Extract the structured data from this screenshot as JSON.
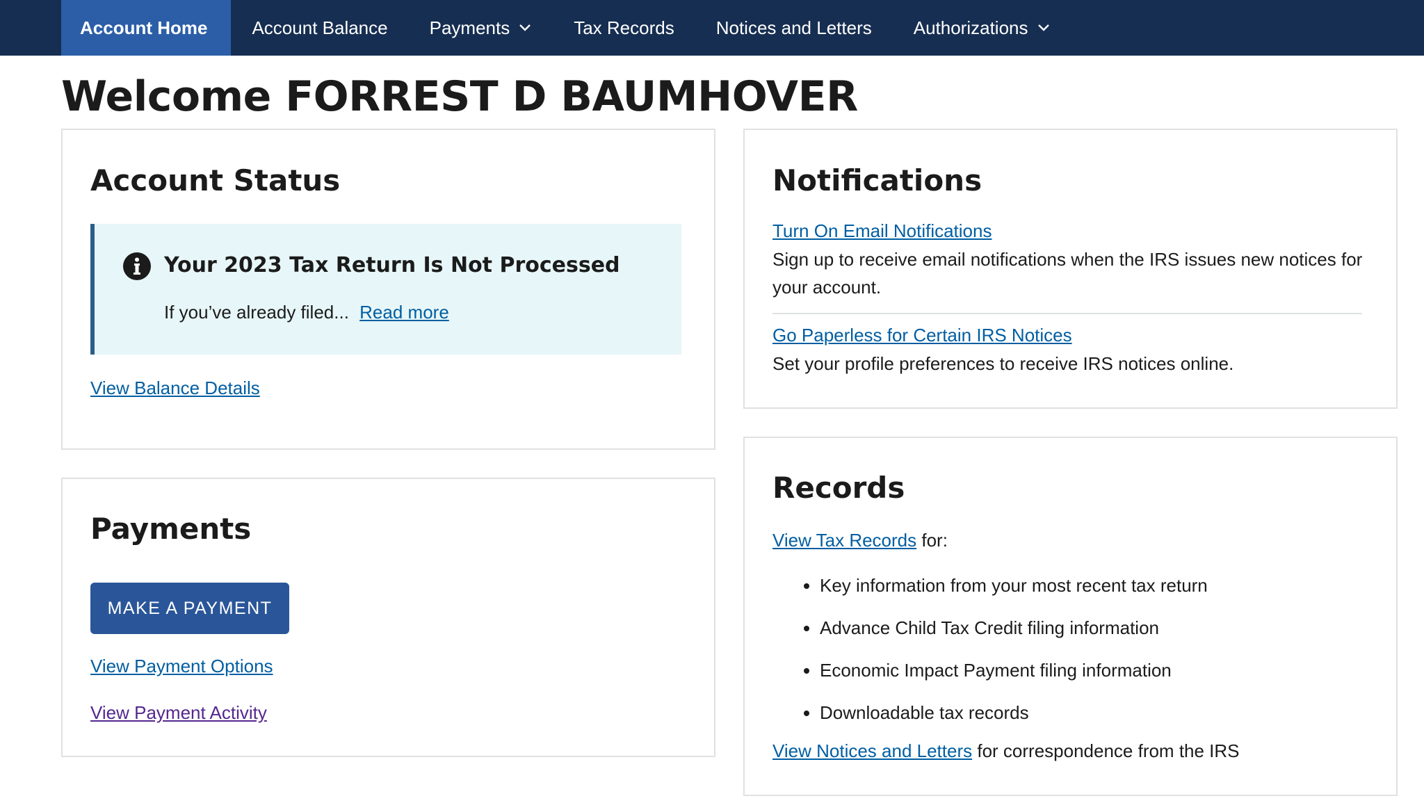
{
  "nav": {
    "items": [
      {
        "label": "Account Home",
        "active": true,
        "dropdown": false
      },
      {
        "label": "Account Balance",
        "active": false,
        "dropdown": false
      },
      {
        "label": "Payments",
        "active": false,
        "dropdown": true
      },
      {
        "label": "Tax Records",
        "active": false,
        "dropdown": false
      },
      {
        "label": "Notices and Letters",
        "active": false,
        "dropdown": false
      },
      {
        "label": "Authorizations",
        "active": false,
        "dropdown": true
      }
    ]
  },
  "page": {
    "title": "Welcome FORREST D BAUMHOVER"
  },
  "account_status": {
    "heading": "Account Status",
    "alert": {
      "icon": "info-icon",
      "title": "Your 2023 Tax Return Is Not Processed",
      "body": "If you’ve already filed...",
      "read_more": "Read more"
    },
    "balance_link": "View Balance Details"
  },
  "payments": {
    "heading": "Payments",
    "make_payment": "MAKE A PAYMENT",
    "options_link": "View Payment Options",
    "activity_link": "View Payment Activity"
  },
  "notifications": {
    "heading": "Notifications",
    "email_link": "Turn On Email Notifications",
    "email_desc": "Sign up to receive email notifications when the IRS issues new notices for your account.",
    "paperless_link": "Go Paperless for Certain IRS Notices",
    "paperless_desc": "Set your profile preferences to receive IRS notices online."
  },
  "records": {
    "heading": "Records",
    "tax_records_link": "View Tax Records",
    "tax_records_suffix": " for:",
    "items": [
      "Key information from your most recent tax return",
      "Advance Child Tax Credit filing information",
      "Economic Impact Payment filing information",
      "Downloadable tax records"
    ],
    "notices_link": "View Notices and Letters",
    "notices_suffix": " for correspondence from the IRS"
  },
  "colors": {
    "nav_background": "#162e51",
    "nav_active": "#2c5ea8",
    "link": "#005ea2",
    "visited_link": "#54278f",
    "button": "#2a5699",
    "alert_background": "#e7f6f8"
  }
}
